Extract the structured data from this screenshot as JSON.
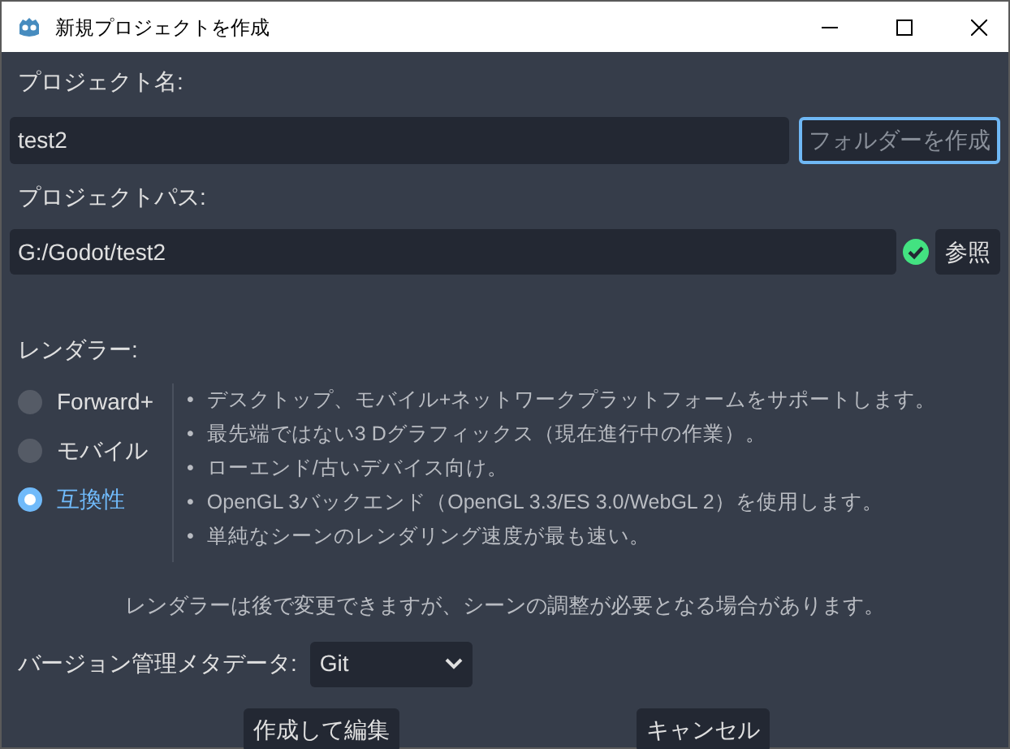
{
  "window": {
    "title": "新規プロジェクトを作成"
  },
  "project_name": {
    "label": "プロジェクト名:",
    "value": "test2",
    "create_folder_button": {
      "label": "フォルダーを作成",
      "focused": true
    }
  },
  "project_path": {
    "label": "プロジェクトパス:",
    "value": "G:/Godot/test2",
    "valid": true,
    "browse_button": "参照"
  },
  "renderer": {
    "label": "レンダラー:",
    "options": [
      {
        "label": "Forward+",
        "selected": false
      },
      {
        "label": "モバイル",
        "selected": false
      },
      {
        "label": "互換性",
        "selected": true
      }
    ],
    "description": [
      {
        "bullet": "•",
        "text": "デスクトップ、モバイル+ネットワークプラットフォームをサポートします。"
      },
      {
        "bullet": "•",
        "text": "最先端ではない3 Dグラフィックス（現在進行中の作業）。"
      },
      {
        "bullet": "•",
        "text": "ローエンド/古いデバイス向け。"
      },
      {
        "bullet": "•",
        "text": "OpenGL 3バックエンド（OpenGL 3.3/ES 3.0/WebGL 2）を使用します。"
      },
      {
        "bullet": "•",
        "text": "単純なシーンのレンダリング速度が最も速い。"
      }
    ],
    "note": "レンダラーは後で変更できますが、シーンの調整が必要となる場合があります。"
  },
  "version_control": {
    "label": "バージョン管理メタデータ:",
    "value": "Git"
  },
  "buttons": [
    {
      "label": "作成して編集"
    },
    {
      "label": "キャンセル"
    }
  ]
}
